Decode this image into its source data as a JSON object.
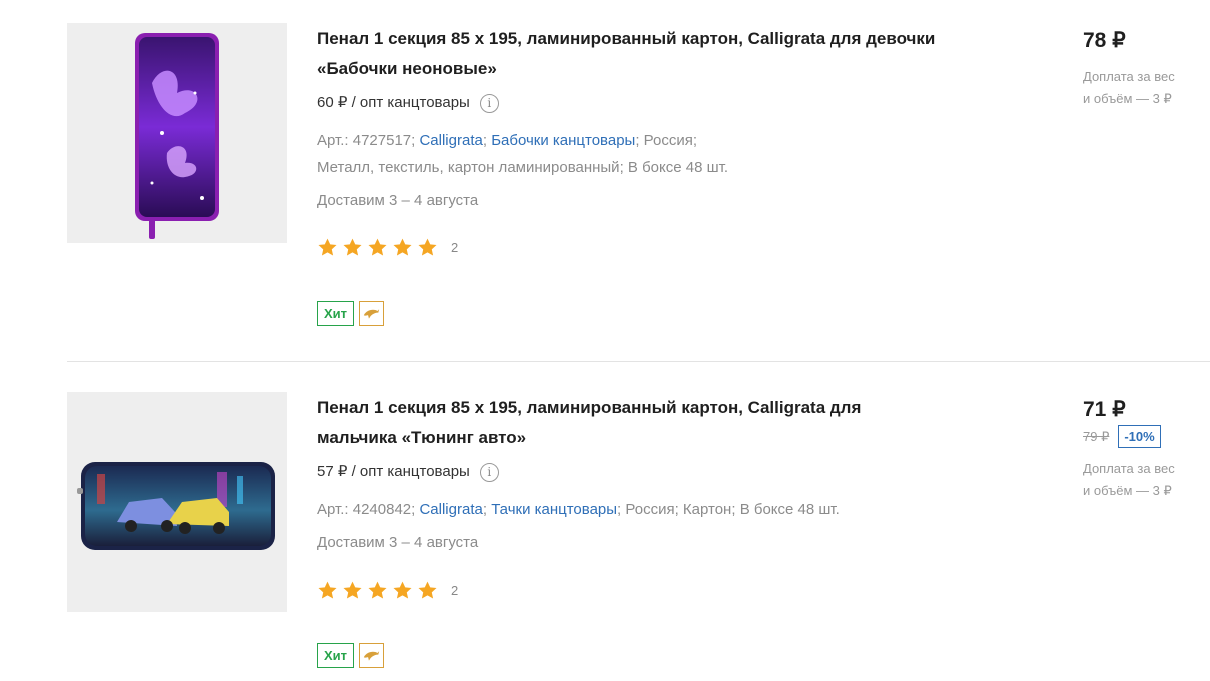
{
  "products": [
    {
      "title": "Пенал 1 секция 85 х 195, ламинированный картон, Calligrata для девочки «Бабочки неоновые»",
      "wholesale": "60 ₽ / опт канцтовары",
      "art": "Арт.: 4727517;",
      "brand": "Calligrata",
      "series": "Бабочки канцтовары",
      "country": "Россия;",
      "material": "Металл, текстиль, картон ламинированный;",
      "box": "В боксе 48 шт.",
      "delivery": "Доставим 3 – 4 августа",
      "rating": 5,
      "reviews": "2",
      "badge": "Хит",
      "price": "78 ₽",
      "surcharge": "Доплата за вес и объём — 3 ₽"
    },
    {
      "title": "Пенал 1 секция 85 х 195, ламинированный картон, Calligrata для мальчика «Тюнинг авто»",
      "wholesale": "57 ₽ / опт канцтовары",
      "art": "Арт.: 4240842;",
      "brand": "Calligrata",
      "series": "Тачки канцтовары",
      "country": "Россия;",
      "material": "Картон;",
      "box": "В боксе 48 шт.",
      "delivery": "Доставим 3 – 4 августа",
      "rating": 5,
      "reviews": "2",
      "badge": "Хит",
      "price": "71 ₽",
      "old_price": "79 ₽",
      "discount": "-10%",
      "surcharge": "Доплата за вес и объём — 3 ₽"
    }
  ],
  "icons": {
    "info": "info-icon",
    "star": "star-icon",
    "dolphin": "dolphin-icon"
  },
  "colors": {
    "link": "#2f6fb7",
    "star": "#f5a623",
    "hit_badge": "#27a34a",
    "dolphin_badge": "#d8a03a"
  }
}
